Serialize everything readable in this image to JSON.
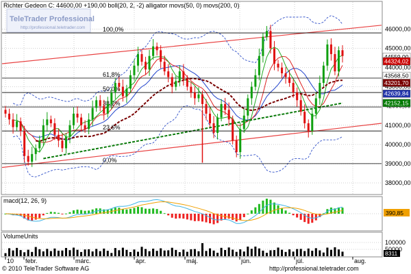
{
  "header": {
    "title": "Richter Gedeon C: 44600,00 +190,00 boll(20, 2, -2) alligator movs(50, 0) movs(200, 0)"
  },
  "watermark": {
    "brand": "TeleTrader Professional",
    "url": "http://professional.teletrader.com"
  },
  "fib": {
    "levels": [
      {
        "label": "100,0%",
        "value": 45800
      },
      {
        "label": "61,8%",
        "value": 43450
      },
      {
        "label": "50,0%",
        "value": 42700
      },
      {
        "label": "38,2%",
        "value": 41950
      },
      {
        "label": "23,6%",
        "value": 40700
      },
      {
        "label": "0,0%",
        "value": 39000
      }
    ]
  },
  "price_tags": [
    {
      "text": "44559,00",
      "value": 44559,
      "bg": "#ffffff",
      "fg": "#000000"
    },
    {
      "text": "44324,02",
      "value": 44324,
      "bg": "#cc0000",
      "fg": "#ffffff"
    },
    {
      "text": "43568,50",
      "value": 43568,
      "bg": "#ffffff",
      "fg": "#000000"
    },
    {
      "text": "43201,70",
      "value": 43201,
      "bg": "#7a0000",
      "fg": "#ffffff"
    },
    {
      "text": "42639,84",
      "value": 42640,
      "bg": "#2233aa",
      "fg": "#ffffff"
    },
    {
      "text": "42152,15",
      "value": 42152,
      "bg": "#007a00",
      "fg": "#ffffff"
    }
  ],
  "macd": {
    "title": "macd(12, 26, 9)",
    "tag": "390,85"
  },
  "volume": {
    "title": "VolumeUnits",
    "tag": "8311"
  },
  "footer": {
    "copyright": "© 2010 TeleTrader Software AG",
    "url": "http://professional.teletrader.com"
  },
  "chart_data": [
    {
      "type": "candlestick",
      "title": "Richter Gedeon C: 44600,00 +190,00 boll(20, 2, -2) alligator movs(50, 0) movs(200, 0)",
      "ylim": [
        37500,
        46800
      ],
      "y_ticks": [
        38000,
        39000,
        40000,
        41000,
        42000,
        43000,
        44000,
        45000,
        46000
      ],
      "y_tick_labels": [
        "38000,00",
        "39000,00",
        "40000,00",
        "41000,00",
        "42000,00",
        "43000,00",
        "44000,00",
        "45000,00",
        "46000,00"
      ],
      "x_tick_labels": [
        "10",
        "febr.",
        "márc.",
        "ápr.",
        "máj.",
        "jún.",
        "júl.",
        "aug."
      ],
      "close": [
        41600,
        41300,
        40900,
        41200,
        40700,
        39400,
        39100,
        39500,
        39800,
        40200,
        41000,
        41300,
        41100,
        40500,
        40200,
        39800,
        40400,
        41000,
        41600,
        41400,
        41000,
        40800,
        41300,
        41900,
        42300,
        42000,
        41600,
        42100,
        42700,
        43200,
        43000,
        42500,
        42900,
        43600,
        44100,
        44700,
        44300,
        43900,
        44600,
        45100,
        44900,
        44300,
        43800,
        43500,
        43000,
        43300,
        43800,
        43400,
        43000,
        42700,
        42400,
        42600,
        42100,
        41600,
        41100,
        40600,
        41400,
        42100,
        41800,
        41300,
        40200,
        39600,
        40800,
        41500,
        42400,
        43000,
        43600,
        44600,
        45600,
        45900,
        45000,
        44200,
        44000,
        43700,
        43500,
        43200,
        42700,
        42300,
        41700,
        41100,
        40700,
        41600,
        42400,
        43200,
        44100,
        45200,
        44700,
        43800,
        44900,
        44600
      ],
      "overlays": [
        "boll(20, 2, -2)",
        "alligator",
        "movs(50, 0)",
        "movs(200, 0)"
      ],
      "grid": true
    },
    {
      "type": "bar",
      "title": "macd(12, 26, 9)",
      "ylim": [
        -900,
        900
      ],
      "last_value": 390.85
    },
    {
      "type": "bar",
      "title": "VolumeUnits",
      "ylim": [
        0,
        130000
      ],
      "y_ticks": [
        50000,
        100000
      ],
      "y_tick_labels": [
        "50000",
        "100000"
      ],
      "last_value": 8311
    }
  ]
}
